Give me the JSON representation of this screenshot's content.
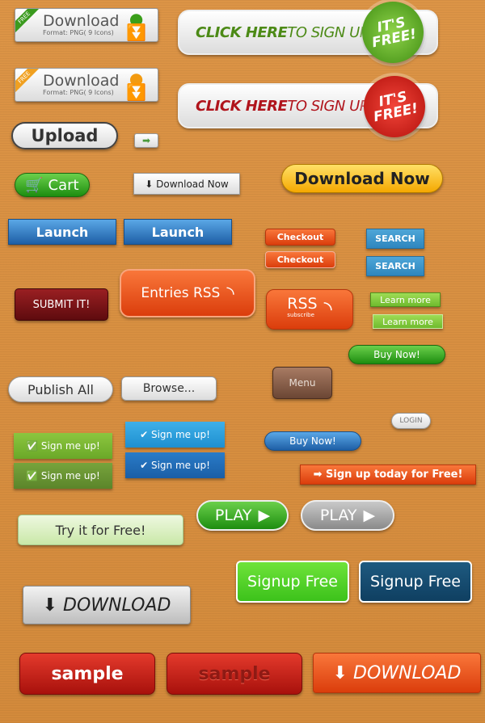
{
  "download_green": {
    "ribbon": "FREE",
    "title": "Download",
    "subtitle": "Format: PNG( 9 Icons)"
  },
  "download_orange": {
    "ribbon": "FREE",
    "title": "Download",
    "subtitle": "Format: PNG( 9 Icons)"
  },
  "signup_green": {
    "bold": "CLICK HERE",
    "rest": " TO SIGN UP",
    "badge": "IT'S FREE!"
  },
  "signup_red": {
    "bold": "CLICK HERE",
    "rest": " TO SIGN UP",
    "badge": "IT'S FREE!"
  },
  "upload": "Upload",
  "cart": "Cart",
  "download_now": "Download Now",
  "download_now_yellow": "Download Now",
  "launch": [
    "Launch",
    "Launch"
  ],
  "checkout": [
    "Checkout",
    "Checkout"
  ],
  "search": [
    "SEARCH",
    "SEARCH"
  ],
  "submit": "SUBMIT IT!",
  "entries_rss": "Entries RSS",
  "rss": {
    "title": "RSS",
    "sub": "subscribe"
  },
  "learn_more": [
    "Learn more",
    "Learn more"
  ],
  "buy_now": [
    "Buy Now!",
    "Buy Now!"
  ],
  "menu": "Menu",
  "publish_all": "Publish All",
  "browse": "Browse...",
  "login": "LOGIN",
  "sign_me_up": [
    "Sign me up!",
    "Sign me up!",
    "Sign me up!",
    "Sign me up!"
  ],
  "sign_up_today": "Sign up today for Free!",
  "play": [
    "PLAY",
    "PLAY"
  ],
  "try_free": "Try it for Free!",
  "signup_free": [
    "Signup Free",
    "Signup Free"
  ],
  "download_big": [
    "DOWNLOAD",
    "DOWNLOAD"
  ],
  "sample": [
    "sample",
    "sample"
  ]
}
